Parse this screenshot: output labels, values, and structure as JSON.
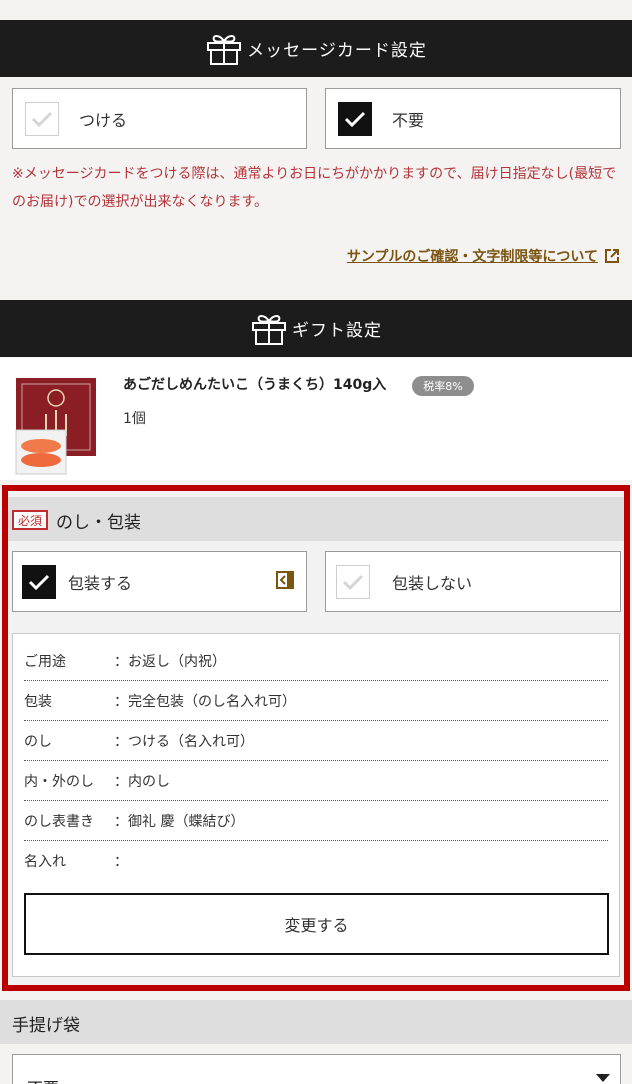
{
  "message_card": {
    "title": "メッセージカード設定",
    "option_attach": "つける",
    "option_none": "不要",
    "notice": "※メッセージカードをつける際は、通常よりお日にちがかかりますので、届け日指定なし(最短でのお届け)での選択が出来なくなります。",
    "sample_link": "サンプルのご確認・文字制限等について"
  },
  "gift": {
    "title": "ギフト設定",
    "product_name": "あごだしめんたいこ（うまくち）140g入",
    "tax_badge": "税率8%",
    "quantity": "1個"
  },
  "noshi": {
    "required": "必須",
    "title": "のし・包装",
    "option_wrap": "包装する",
    "option_nowrap": "包装しない",
    "rows": [
      {
        "key": "ご用途",
        "value": "：お返し（内祝）"
      },
      {
        "key": "包装",
        "value": "：完全包装（のし名入れ可）"
      },
      {
        "key": "のし",
        "value": "：つける（名入れ可）"
      },
      {
        "key": "内・外のし",
        "value": "：内のし"
      },
      {
        "key": "のし表書き",
        "value": "：御礼 慶（蝶結び）"
      },
      {
        "key": "名入れ",
        "value": "："
      }
    ],
    "change_button": "変更する"
  },
  "bag": {
    "title": "手提げ袋",
    "selected": "不要"
  }
}
